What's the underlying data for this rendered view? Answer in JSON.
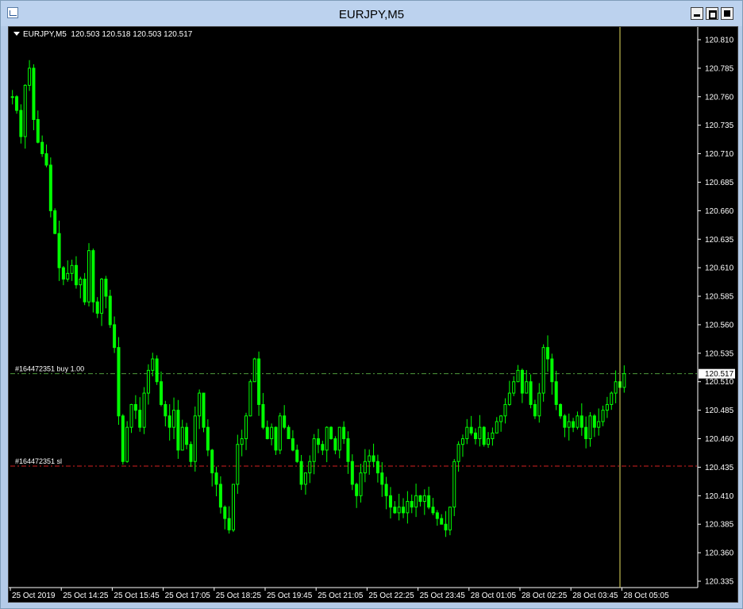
{
  "window": {
    "title": "EURJPY,M5"
  },
  "chart_info": {
    "symbol": "EURJPY,M5",
    "ohlc": "120.503 120.518 120.503 120.517"
  },
  "colors": {
    "background": "#000000",
    "bull": "#00ff00",
    "bear": "#00ff00",
    "buy_line": "#4f9a3c",
    "sl_line": "#d42020",
    "cursor_line": "#e8e060",
    "axis_text": "#ffffff"
  },
  "levels": {
    "buy": {
      "label": "#164472351 buy 1.00",
      "price": 120.517
    },
    "sl": {
      "label": "#164472351 sl",
      "price": 120.436
    }
  },
  "current_price_label": "120.517",
  "chart_data": {
    "type": "candlestick",
    "symbol": "EURJPY",
    "timeframe": "M5",
    "ylim": [
      120.335,
      120.81
    ],
    "y_ticks": [
      "120.810",
      "120.785",
      "120.760",
      "120.735",
      "120.710",
      "120.685",
      "120.660",
      "120.635",
      "120.610",
      "120.585",
      "120.560",
      "120.535",
      "120.510",
      "120.485",
      "120.460",
      "120.435",
      "120.410",
      "120.385",
      "120.360",
      "120.335"
    ],
    "x_ticks": [
      "25 Oct 2019",
      "25 Oct 14:25",
      "25 Oct 15:45",
      "25 Oct 17:05",
      "25 Oct 18:25",
      "25 Oct 19:45",
      "25 Oct 21:05",
      "25 Oct 22:25",
      "25 Oct 23:45",
      "28 Oct 01:05",
      "28 Oct 02:25",
      "28 Oct 03:45",
      "28 Oct 05:05"
    ],
    "closes": [
      120.76,
      120.748,
      120.725,
      120.77,
      120.785,
      120.74,
      120.72,
      120.71,
      120.7,
      120.66,
      120.64,
      120.61,
      120.6,
      120.605,
      120.612,
      120.595,
      120.6,
      120.58,
      120.625,
      120.58,
      120.57,
      120.6,
      120.585,
      120.56,
      120.54,
      120.48,
      120.44,
      120.47,
      120.49,
      120.485,
      120.47,
      120.5,
      120.52,
      120.53,
      120.51,
      120.49,
      120.48,
      120.47,
      120.485,
      120.45,
      120.47,
      120.455,
      120.44,
      120.48,
      120.5,
      120.47,
      120.45,
      120.43,
      120.42,
      120.4,
      120.39,
      120.38,
      120.42,
      120.455,
      120.46,
      120.48,
      120.51,
      120.53,
      120.49,
      120.47,
      120.46,
      120.47,
      120.45,
      120.48,
      120.47,
      120.46,
      120.45,
      120.44,
      120.42,
      120.43,
      120.44,
      120.46,
      120.455,
      120.45,
      120.47,
      120.46,
      120.45,
      120.47,
      120.46,
      120.44,
      120.42,
      120.41,
      120.43,
      120.44,
      120.445,
      120.44,
      120.43,
      120.42,
      120.41,
      120.4,
      120.395,
      120.4,
      120.395,
      120.405,
      120.4,
      120.41,
      120.405,
      120.41,
      120.4,
      120.395,
      120.39,
      120.385,
      120.38,
      120.4,
      120.44,
      120.455,
      120.46,
      120.47,
      120.465,
      120.46,
      120.47,
      120.455,
      120.46,
      120.465,
      120.475,
      120.48,
      120.49,
      120.5,
      120.51,
      120.52,
      120.5,
      120.51,
      120.49,
      120.48,
      120.5,
      120.54,
      120.53,
      120.51,
      120.49,
      120.48,
      120.47,
      120.475,
      120.47,
      120.48,
      120.47,
      120.46,
      120.48,
      120.47,
      120.475,
      120.485,
      120.49,
      120.5,
      120.51,
      120.505,
      120.517
    ]
  }
}
